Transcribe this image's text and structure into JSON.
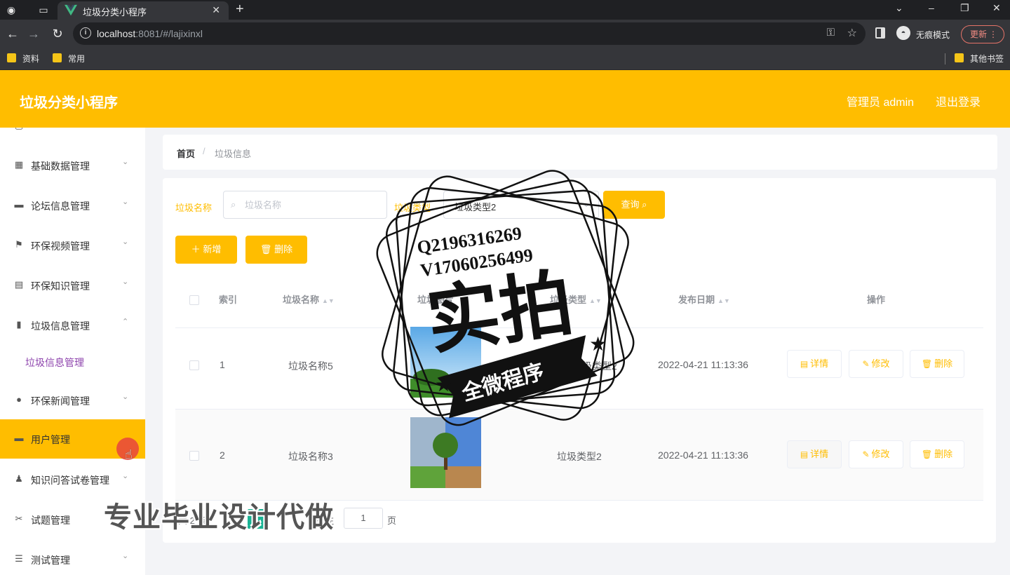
{
  "browser": {
    "tab_title": "垃圾分类小程序",
    "url_host": "localhost",
    "url_rest": ":8081/#/lajixinxl",
    "incognito_label": "无痕模式",
    "update_label": "更新",
    "bookmarks": [
      "资料",
      "常用"
    ],
    "other_bookmarks": "其他书签"
  },
  "header": {
    "title": "垃圾分类小程序",
    "user": "管理员 admin",
    "logout": "退出登录"
  },
  "sidebar": {
    "items": [
      {
        "label": "基础数据管理",
        "icon": "grid-icon"
      },
      {
        "label": "论坛信息管理",
        "icon": "monitor-icon"
      },
      {
        "label": "环保视频管理",
        "icon": "flag-icon"
      },
      {
        "label": "环保知识管理",
        "icon": "document-icon"
      },
      {
        "label": "垃圾信息管理",
        "icon": "bar-chart-icon"
      },
      {
        "label": "环保新闻管理",
        "icon": "bulb-icon"
      },
      {
        "label": "用户管理",
        "icon": "chat-icon"
      },
      {
        "label": "知识问答试卷管理",
        "icon": "user-icon"
      },
      {
        "label": "试题管理",
        "icon": "ticket-icon"
      },
      {
        "label": "测试管理",
        "icon": "list-icon"
      }
    ],
    "sub_item": "垃圾信息管理"
  },
  "breadcrumb": {
    "home": "首页",
    "separator": "/",
    "current": "垃圾信息"
  },
  "filters": {
    "name_label": "垃圾名称",
    "name_placeholder": "垃圾名称",
    "type_label": "垃圾类型",
    "type_value": "垃圾类型2",
    "query_button": "查询"
  },
  "actions": {
    "add": "新增",
    "delete": "删除"
  },
  "table": {
    "columns": [
      "索引",
      "垃圾名称",
      "垃圾图片",
      "垃圾类型",
      "发布日期",
      "操作"
    ],
    "rows": [
      {
        "index": "1",
        "name": "垃圾名称5",
        "type": "垃圾类型2",
        "date": "2022-04-21 11:13:36"
      },
      {
        "index": "2",
        "name": "垃圾名称3",
        "type": "垃圾类型2",
        "date": "2022-04-21 11:13:36"
      }
    ],
    "row_actions": {
      "detail": "详情",
      "edit": "修改",
      "delete": "删除"
    }
  },
  "pagination": {
    "total": "共 2 条",
    "current_page": "1",
    "goto_label": "前往",
    "goto_value": "1",
    "page_suffix": "页"
  },
  "watermark": {
    "line1": "Q2196316269",
    "line2": "V17060256499",
    "big": "实拍",
    "ribbon": "全微程序",
    "caption": "专业毕业设计代做"
  },
  "colors": {
    "accent": "#ffbd00",
    "sub_active": "#8e44ad",
    "page_active": "#19b394"
  }
}
